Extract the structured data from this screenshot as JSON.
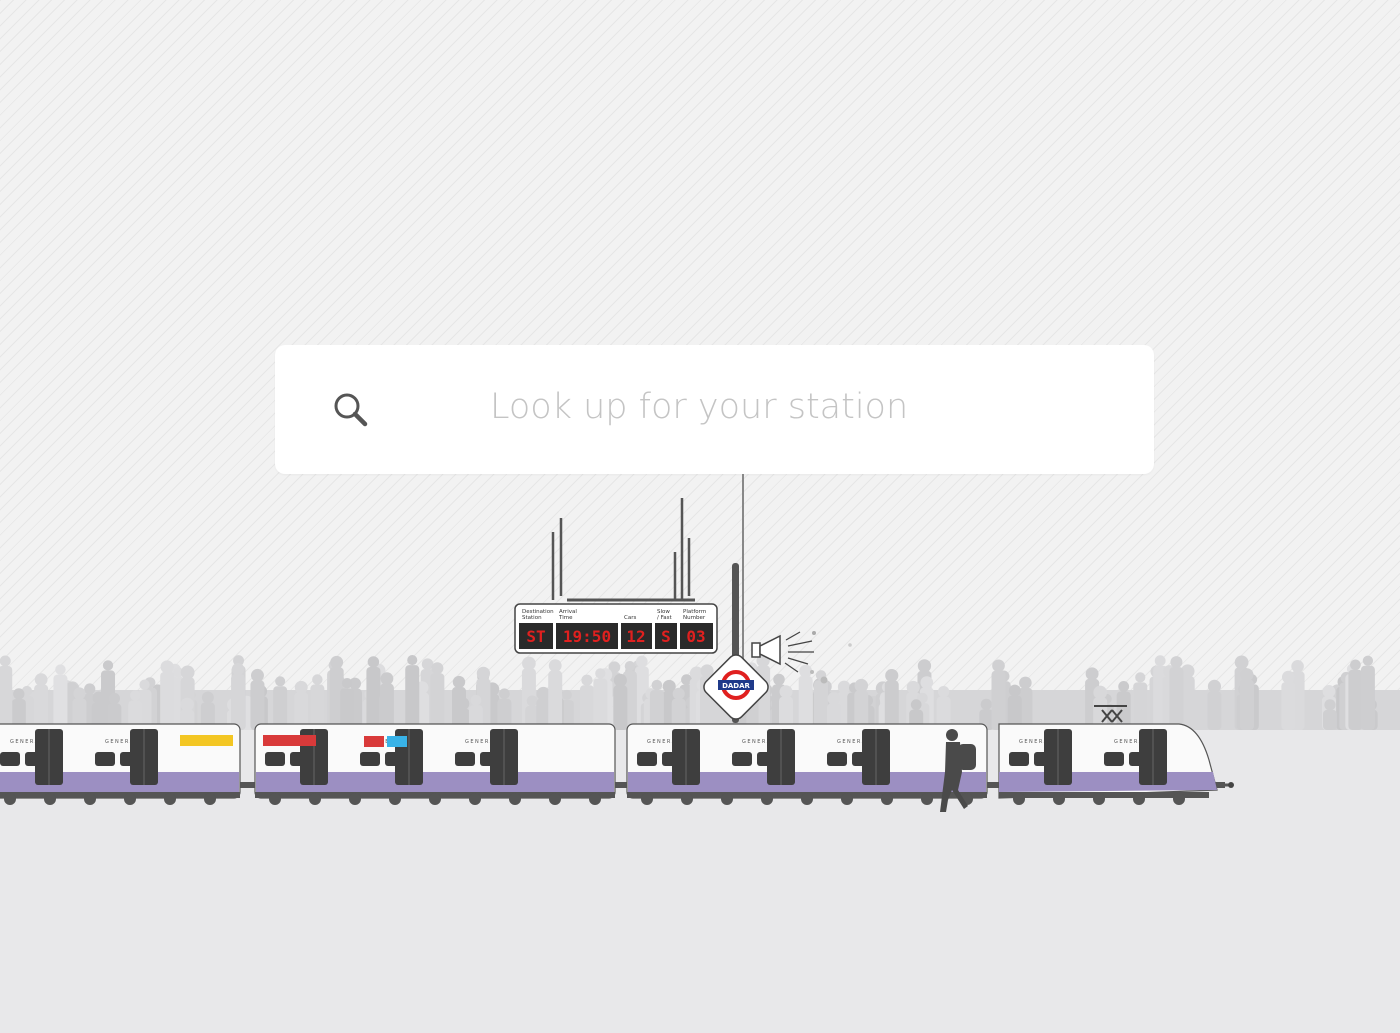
{
  "search": {
    "placeholder": "Look up for your station",
    "icon": "search-icon"
  },
  "departure_board": {
    "labels": {
      "destination": [
        "Destination",
        "Station"
      ],
      "arrival": [
        "Arrival",
        "Time"
      ],
      "cars": "Cars",
      "slow_fast": [
        "Slow",
        "/ Fast"
      ],
      "platform": [
        "Platform",
        "Number"
      ]
    },
    "values": {
      "destination": "ST",
      "arrival": "19:50",
      "cars": "12",
      "slow_fast": "S",
      "platform": "03"
    }
  },
  "station_sign": {
    "name": "DADAR"
  },
  "train": {
    "car_label": "GENERAL"
  },
  "colors": {
    "sky": "#f2f2f2",
    "ground": "#e8e8ea",
    "train_stripe": "#9c8fc2",
    "board_digits": "#e0201f",
    "sign_ring": "#e0201f",
    "sign_bar": "#1f3a8a"
  }
}
